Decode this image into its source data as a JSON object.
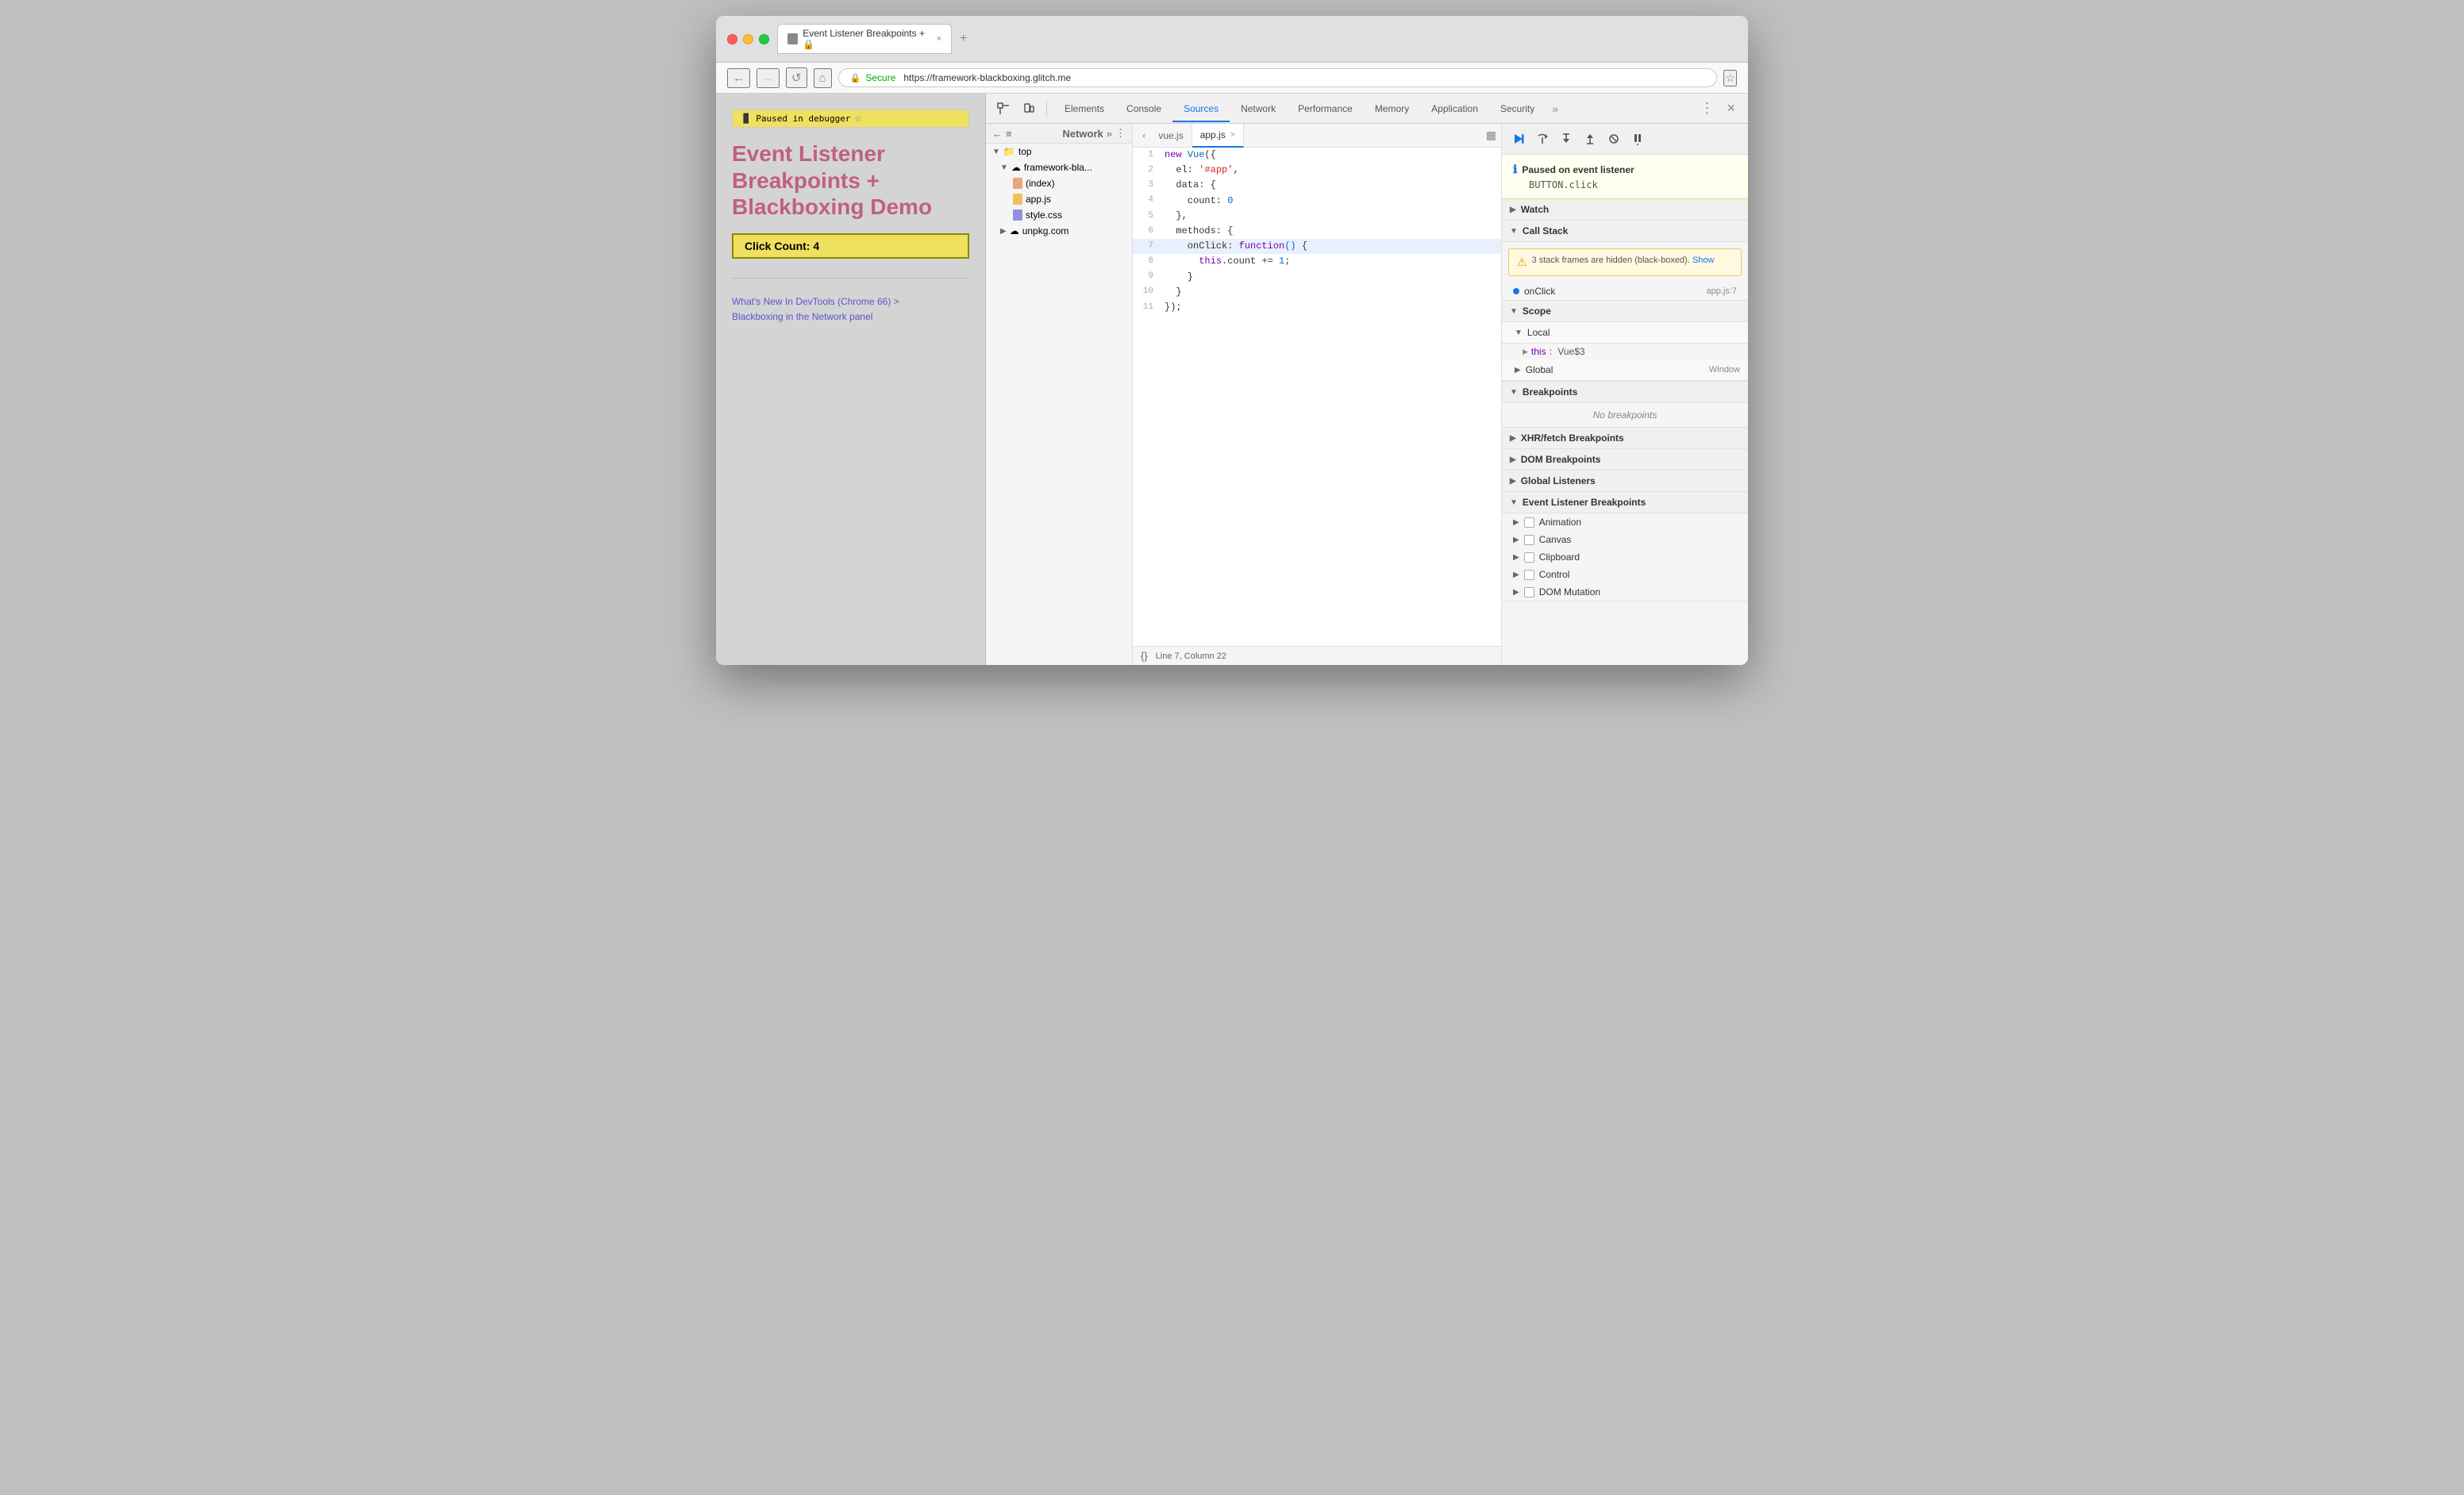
{
  "browser": {
    "title": "Event Listener Breakpoints + 🔒",
    "tab_label": "Event Listener Breakpoints + 🔒",
    "new_tab_symbol": "+",
    "close_symbol": "×"
  },
  "addressbar": {
    "back": "←",
    "forward": "→",
    "refresh": "↺",
    "home": "⌂",
    "secure_label": "Secure",
    "url": "https://framework-blackboxing.glitch.me",
    "star": "☆"
  },
  "preview": {
    "paused_label": "Paused in debugger",
    "page_title": "Event Listener Breakpoints + Blackboxing Demo",
    "click_count_label": "Click Count: 4",
    "link1": "What's New In DevTools (Chrome 66) >",
    "link2": "Blackboxing in the Network panel"
  },
  "devtools": {
    "tabs": [
      "Elements",
      "Console",
      "Sources",
      "Network",
      "Performance",
      "Memory",
      "Application",
      "Security"
    ],
    "active_tab": "Sources",
    "more_label": "»",
    "close_label": "×",
    "menu_label": "⋮"
  },
  "filetree": {
    "header_icons": [
      "←",
      "≡"
    ],
    "items": [
      {
        "indent": 0,
        "arrow": "▼",
        "icon": "folder",
        "label": "top"
      },
      {
        "indent": 1,
        "arrow": "▼",
        "icon": "cloud",
        "label": "framework-bla..."
      },
      {
        "indent": 2,
        "arrow": "",
        "icon": "html",
        "label": "(index)"
      },
      {
        "indent": 2,
        "arrow": "",
        "icon": "js",
        "label": "app.js"
      },
      {
        "indent": 2,
        "arrow": "",
        "icon": "css",
        "label": "style.css"
      },
      {
        "indent": 1,
        "arrow": "▶",
        "icon": "cloud",
        "label": "unpkg.com"
      }
    ]
  },
  "editor": {
    "tabs": [
      {
        "label": "vue.js",
        "active": false,
        "closeable": false
      },
      {
        "label": "app.js",
        "active": true,
        "closeable": true
      }
    ],
    "lines": [
      {
        "num": 1,
        "code": "new Vue({",
        "highlight": false
      },
      {
        "num": 2,
        "code": "  el: '#app',",
        "highlight": false
      },
      {
        "num": 3,
        "code": "  data: {",
        "highlight": false
      },
      {
        "num": 4,
        "code": "    count: 0",
        "highlight": false
      },
      {
        "num": 5,
        "code": "  },",
        "highlight": false
      },
      {
        "num": 6,
        "code": "  methods: {",
        "highlight": false
      },
      {
        "num": 7,
        "code": "    onClick: function() {",
        "highlight": true
      },
      {
        "num": 8,
        "code": "      this.count += 1;",
        "highlight": false
      },
      {
        "num": 9,
        "code": "    }",
        "highlight": false
      },
      {
        "num": 10,
        "code": "  }",
        "highlight": false
      },
      {
        "num": 11,
        "code": "});",
        "highlight": false
      }
    ],
    "status_line": "Line 7, Column 22",
    "format_btn": "{}"
  },
  "debugpanel": {
    "toolbar_buttons": [
      "▶",
      "⤼",
      "↓",
      "↑",
      "⇥",
      "⏸"
    ],
    "paused_on_label": "Paused on event listener",
    "paused_event": "BUTTON.click",
    "sections": {
      "watch": {
        "label": "Watch",
        "collapsed": true
      },
      "callstack": {
        "label": "Call Stack",
        "expanded": true,
        "warning": "3 stack frames are hidden (black-boxed).",
        "show_label": "Show",
        "frames": [
          {
            "fn": "onClick",
            "file": "app.js:7"
          }
        ]
      },
      "scope": {
        "label": "Scope",
        "expanded": true,
        "groups": [
          {
            "type": "Local",
            "items": [
              {
                "key": "this",
                "val": "Vue$3"
              }
            ]
          },
          {
            "type": "Global",
            "right": "Window"
          }
        ]
      },
      "breakpoints": {
        "label": "Breakpoints",
        "expanded": true,
        "empty_label": "No breakpoints"
      },
      "xhr": {
        "label": "XHR/fetch Breakpoints",
        "collapsed": true
      },
      "dom": {
        "label": "DOM Breakpoints",
        "collapsed": true
      },
      "global_listeners": {
        "label": "Global Listeners",
        "collapsed": true
      },
      "event_listener": {
        "label": "Event Listener Breakpoints",
        "expanded": true,
        "items": [
          "Animation",
          "Canvas",
          "Clipboard",
          "Control",
          "DOM Mutation"
        ]
      }
    }
  }
}
